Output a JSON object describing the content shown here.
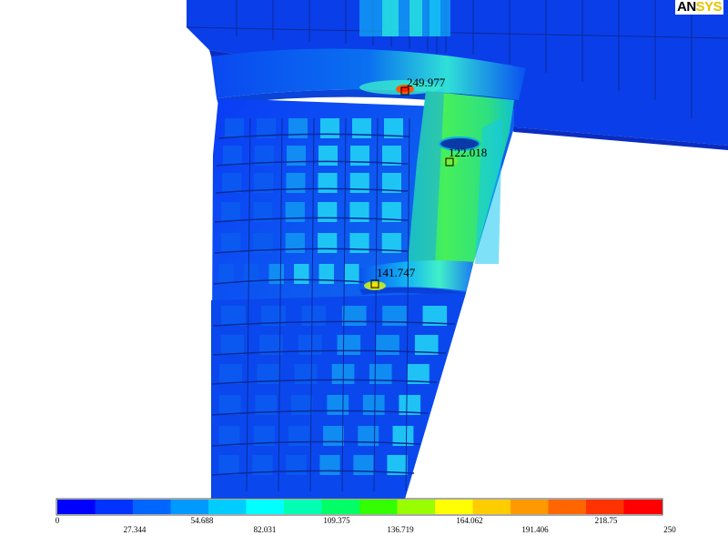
{
  "logo": {
    "part1": "AN",
    "part2": "SYS"
  },
  "colors": {
    "scale": [
      "#0000ff",
      "#0033ff",
      "#0066ff",
      "#0099ff",
      "#00ccff",
      "#00ffff",
      "#00ffb3",
      "#00ff66",
      "#33ff00",
      "#99ff00",
      "#ffff00",
      "#ffcc00",
      "#ff9900",
      "#ff6600",
      "#ff3300",
      "#ff0000"
    ]
  },
  "probes": [
    {
      "label": "249.977",
      "level": 250
    },
    {
      "label": "122.018",
      "level": 122
    },
    {
      "label": "141.747",
      "level": 142
    }
  ],
  "legend": {
    "min": 0,
    "max": 250,
    "ticks_top": [
      "0",
      "54.688",
      "109.375",
      "164.062",
      "218.75"
    ],
    "ticks_bottom": [
      "27.344",
      "82.031",
      "136.719",
      "191.406"
    ],
    "tick_last": "250"
  }
}
